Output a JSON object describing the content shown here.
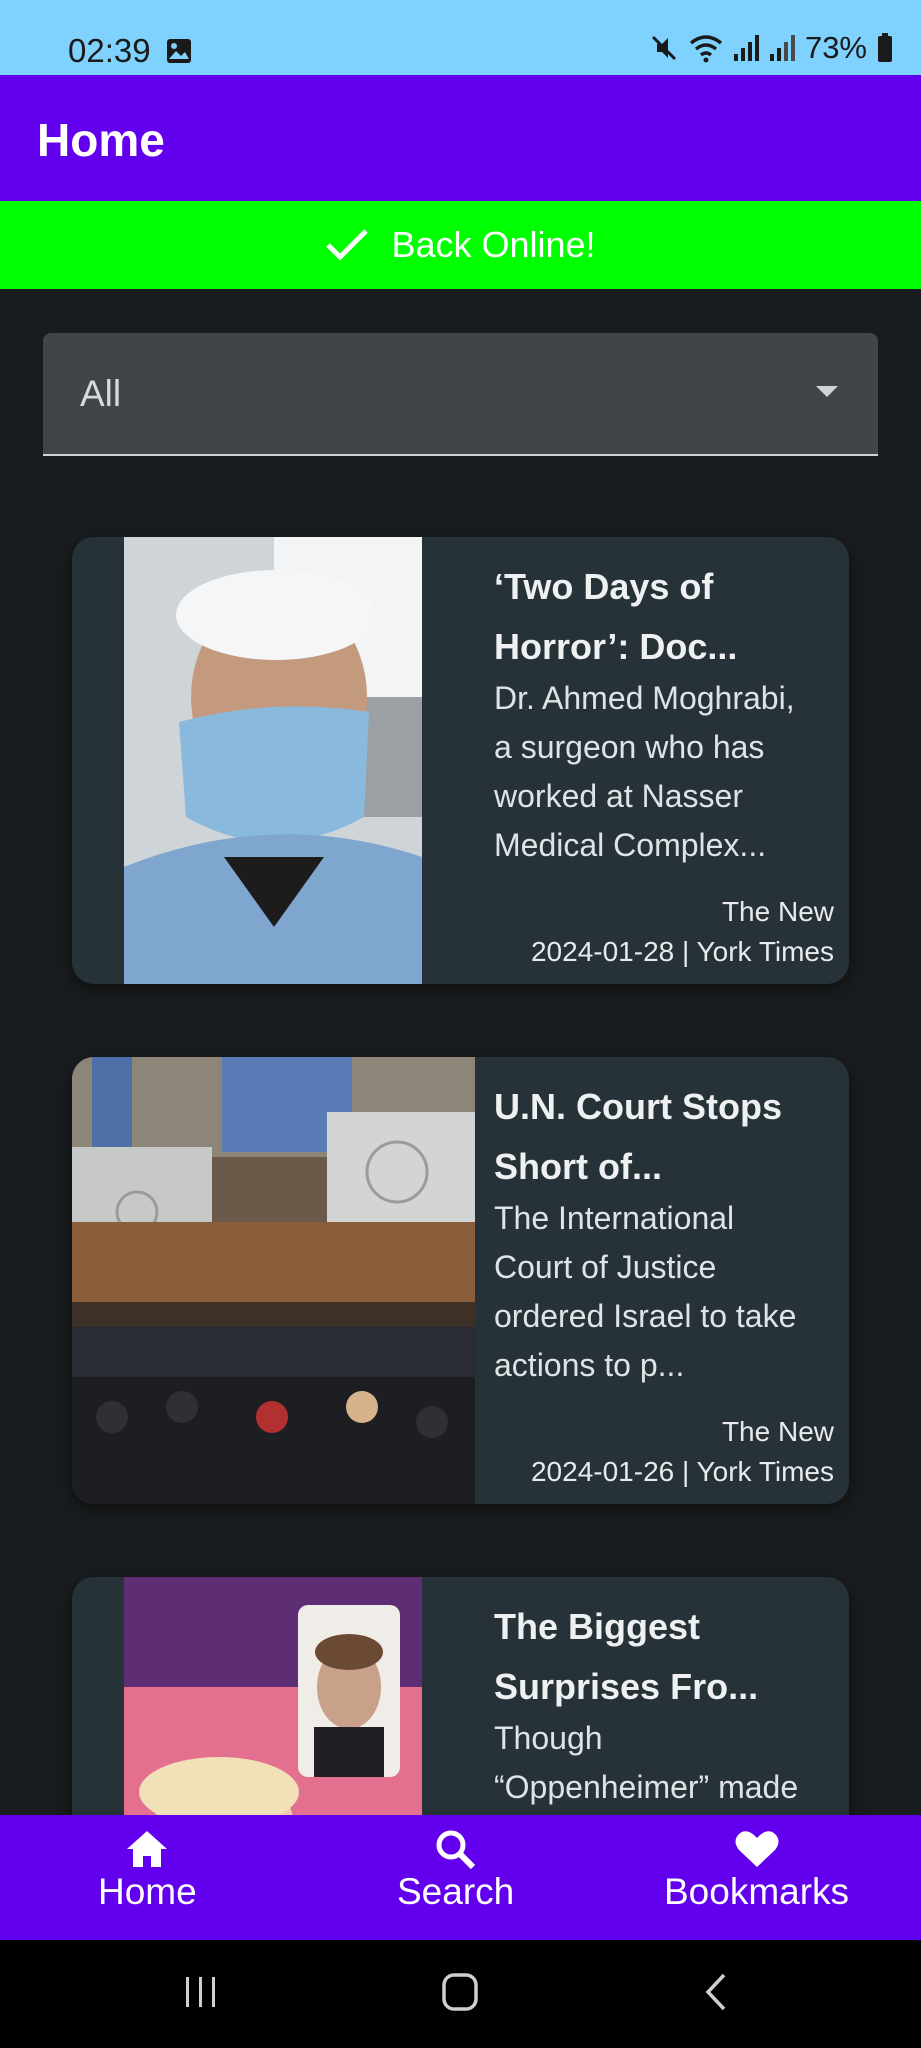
{
  "status": {
    "time": "02:39",
    "battery": "73%",
    "icons": [
      "gallery-icon",
      "mute-icon",
      "wifi-icon",
      "signal-icon",
      "signal-icon",
      "battery-icon"
    ]
  },
  "app": {
    "title": "Home"
  },
  "banner": {
    "text": "Back Online!",
    "icon": "check-icon",
    "color": "#00ff00"
  },
  "filter": {
    "selected": "All",
    "icon": "dropdown-arrow-icon"
  },
  "articles": [
    {
      "title_line1": "‘Two Days of",
      "title_line2": "Horror’: Doc...",
      "desc_lines": [
        "Dr. Ahmed Moghrabi,",
        "a surgeon who has",
        "worked at Nasser",
        "Medical Complex..."
      ],
      "source_line1": "The New",
      "source_line2": "2024-01-28 | York Times"
    },
    {
      "title_line1": "U.N. Court Stops",
      "title_line2": "Short of...",
      "desc_lines": [
        "The International",
        "Court of Justice",
        "ordered Israel to take",
        "actions to p..."
      ],
      "source_line1": "The New",
      "source_line2": "2024-01-26 | York Times"
    },
    {
      "title_line1": "The Biggest",
      "title_line2": "Surprises Fro...",
      "desc_lines": [
        "Though",
        "“Oppenheimer” made"
      ],
      "source_line1": "",
      "source_line2": ""
    }
  ],
  "nav": {
    "home": "Home",
    "search": "Search",
    "bookmarks": "Bookmarks"
  },
  "colors": {
    "primary": "#6200ee",
    "status_bar": "#7fd2fe",
    "card": "#263238",
    "background": "#191c1e"
  }
}
